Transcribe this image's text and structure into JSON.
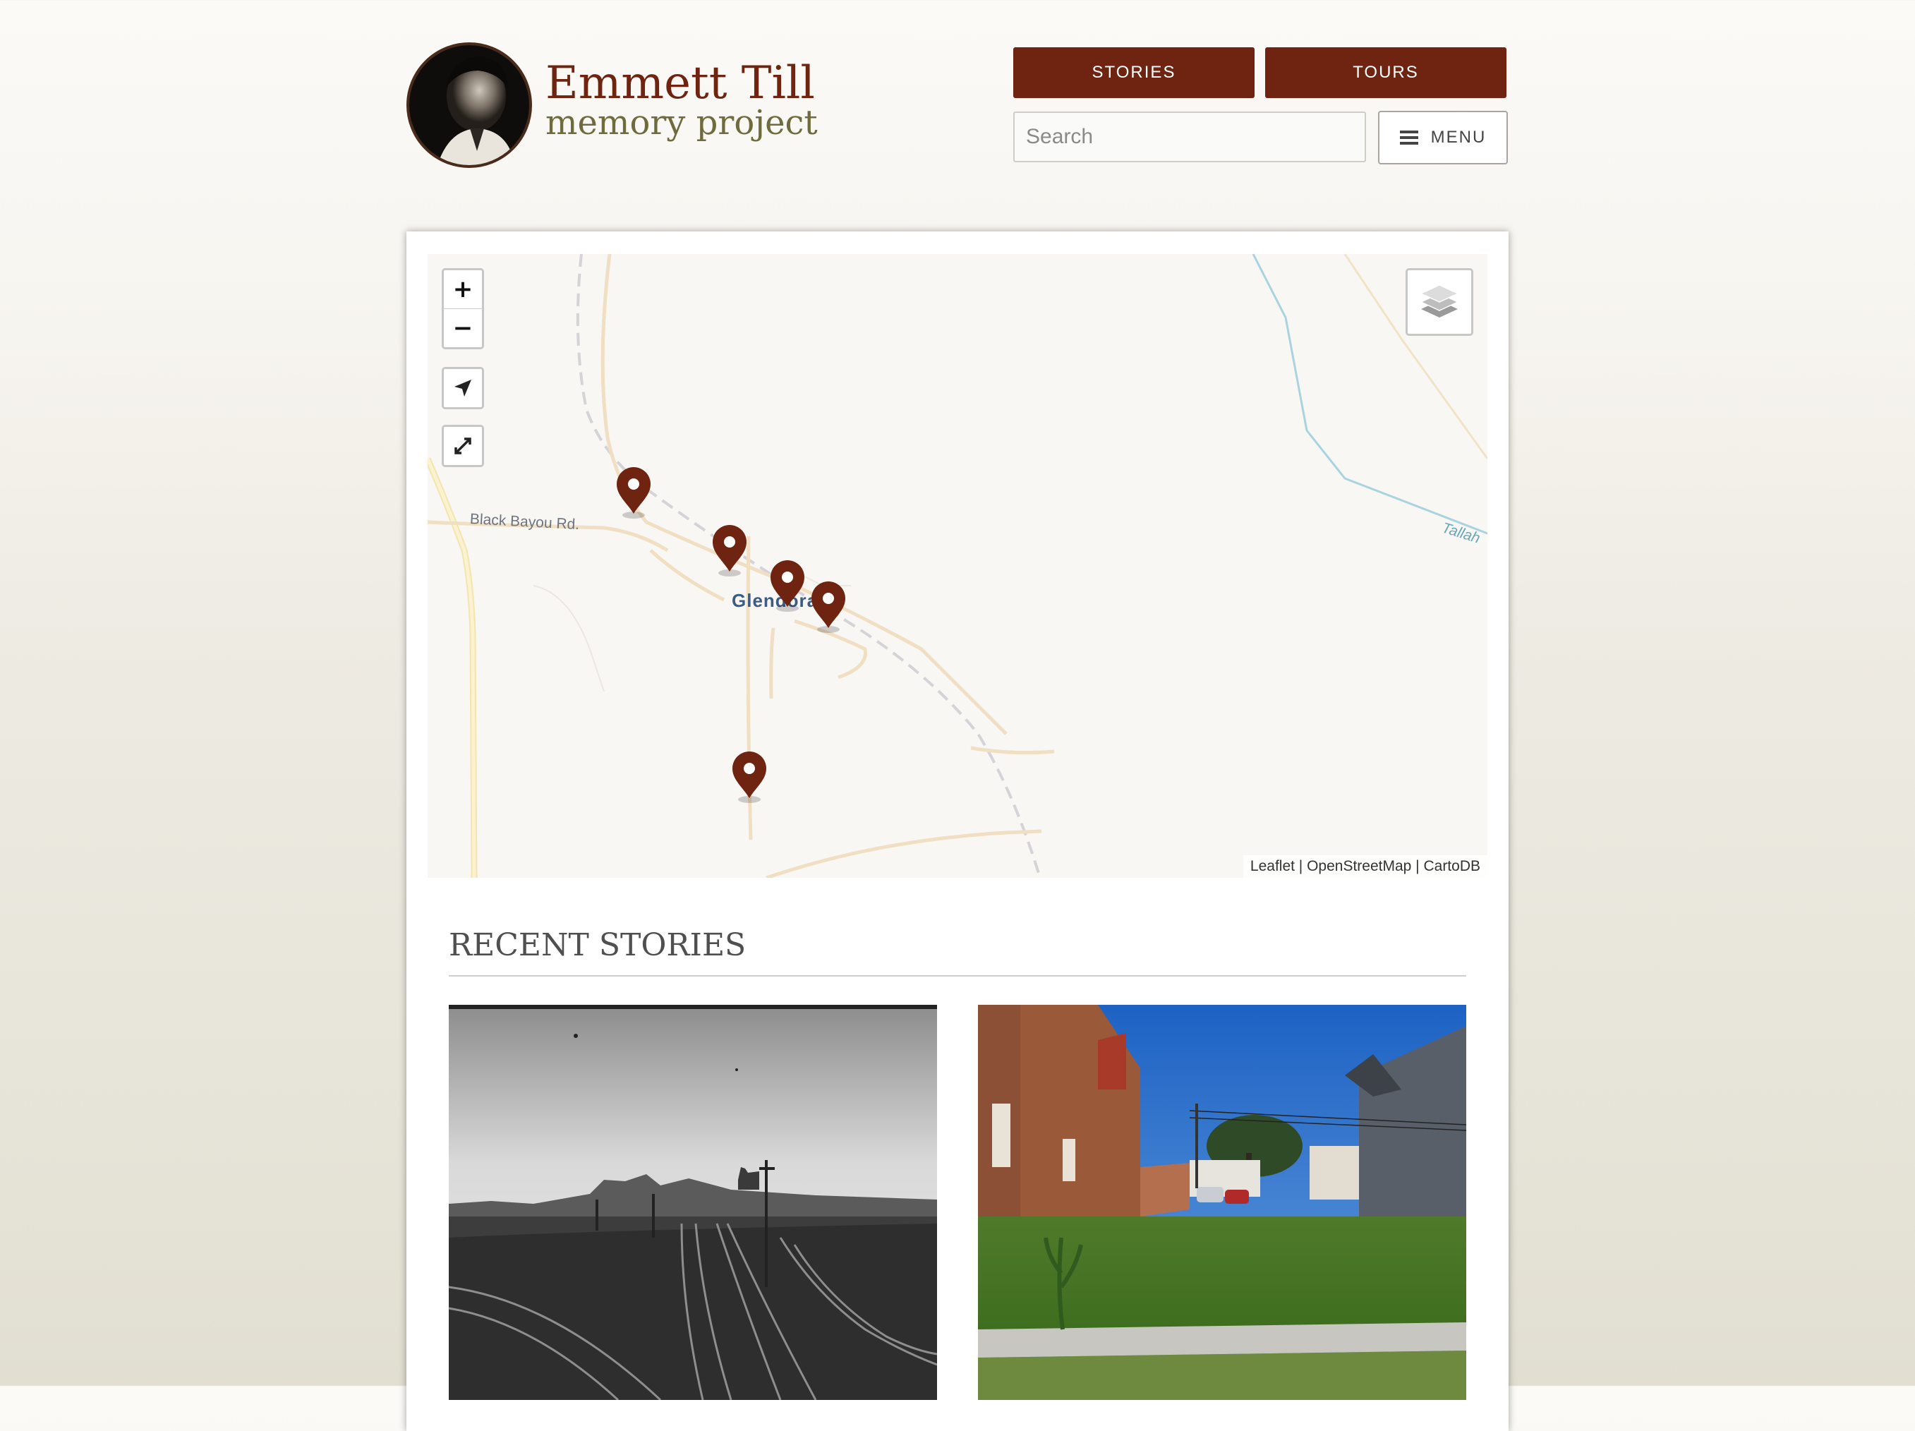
{
  "header": {
    "logo_title": "Emmett Till",
    "logo_subtitle": "memory project",
    "nav": {
      "stories_label": "STORIES",
      "tours_label": "TOURS"
    },
    "search": {
      "placeholder": "Search",
      "value": ""
    },
    "menu_label": "MENU"
  },
  "map": {
    "zoom_in": "+",
    "zoom_out": "−",
    "town_label": "Glendora",
    "road_labels": [
      "Black Bayou Rd.",
      "Tallah"
    ],
    "attribution": "Leaflet | OpenStreetMap | CartoDB",
    "marker_count": 5,
    "icons": [
      "locate-icon",
      "fullscreen-icon",
      "layers-icon",
      "map-marker-icon"
    ]
  },
  "recent_stories": {
    "title": "RECENT STORIES"
  },
  "colors": {
    "brand": "#6e2410",
    "subtitle": "#6f6b3c",
    "marker": "#6e2410"
  }
}
